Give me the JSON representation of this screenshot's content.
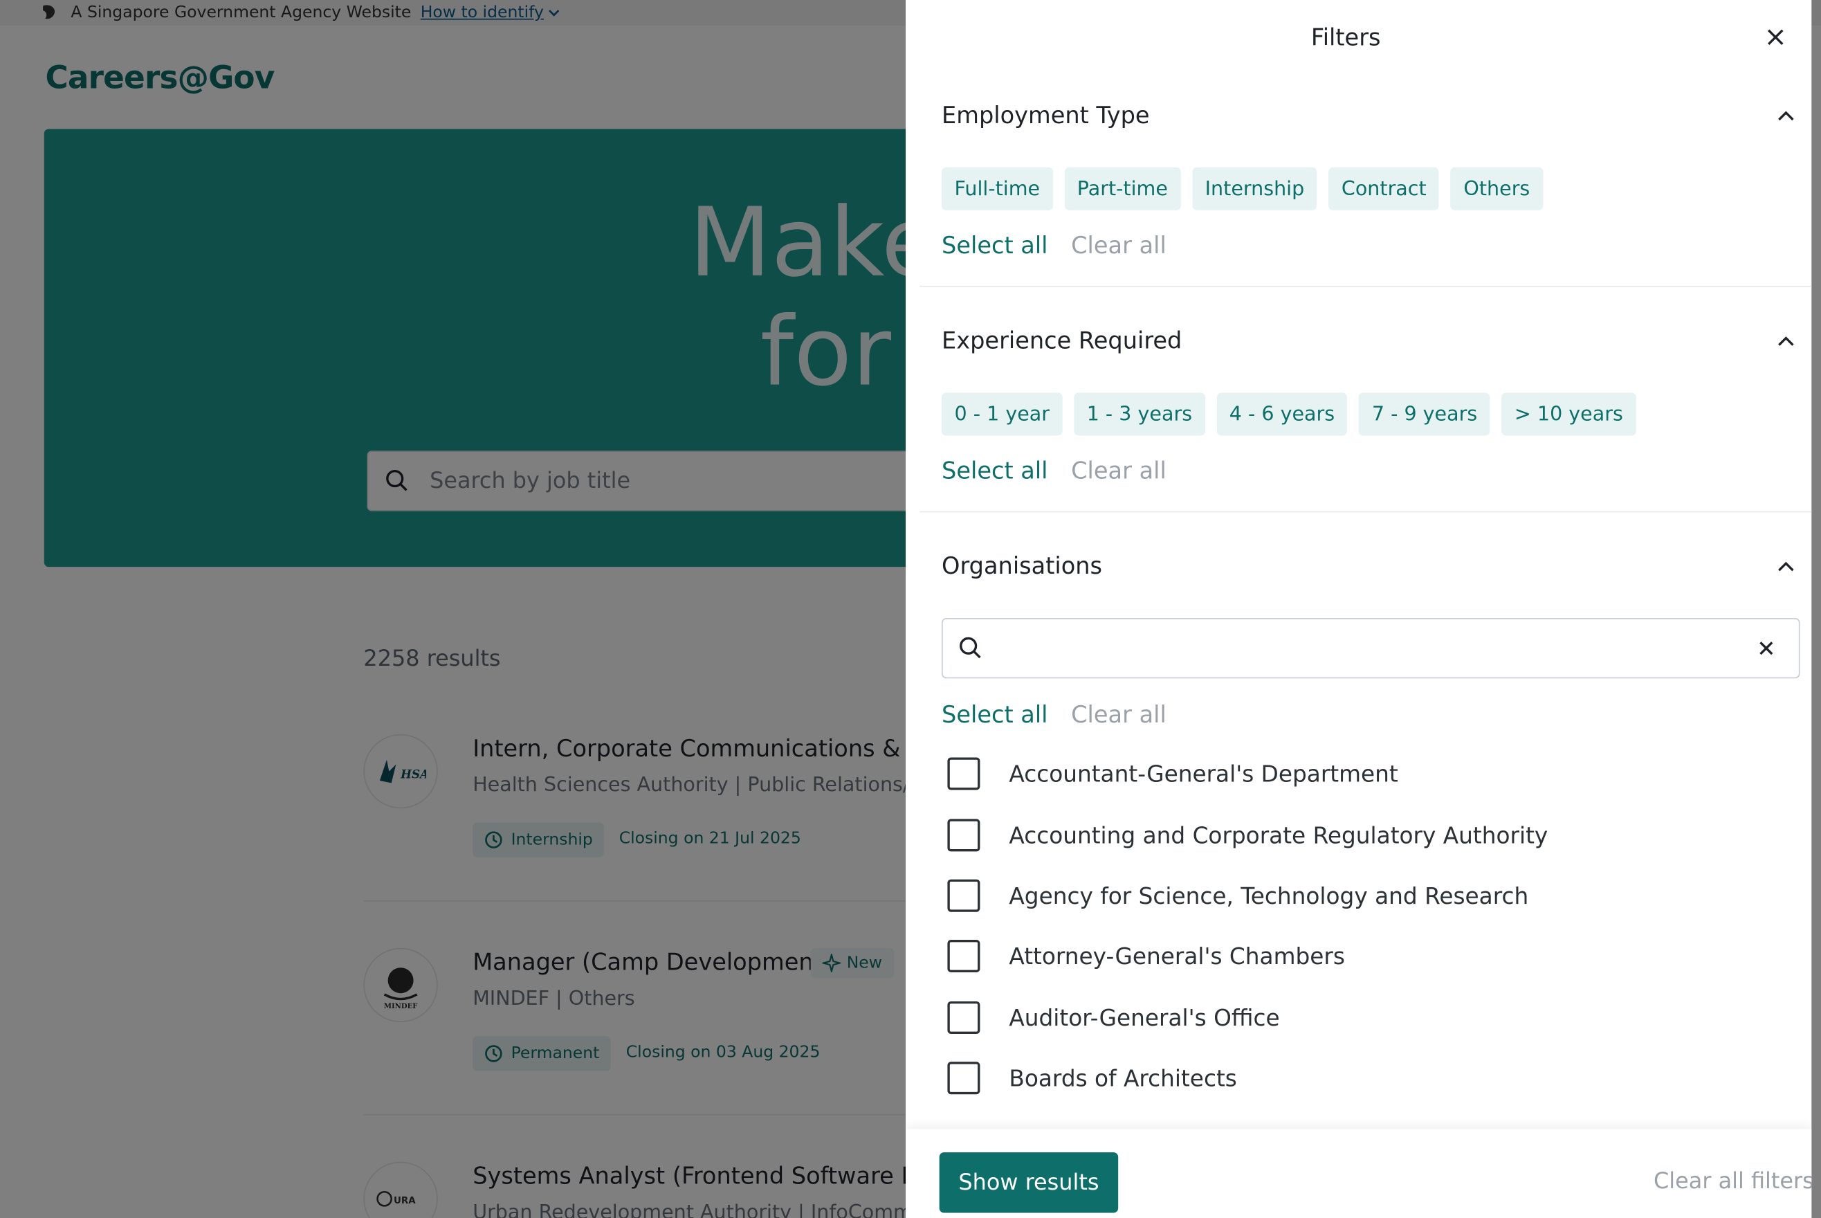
{
  "masthead": {
    "text": "A Singapore Government Agency Website",
    "link": "How to identify"
  },
  "brand": {
    "logo_text": "Careers@Gov"
  },
  "hero": {
    "headline_line1": "Make a D",
    "headline_line2": "for Tor",
    "search_placeholder": "Search by job title"
  },
  "results": {
    "count_text": "2258 results",
    "jobs": [
      {
        "title": "Intern, Corporate Communications & Serv",
        "subtitle": "Health Sciences Authority | Public Relations/Co",
        "type": "Internship",
        "closing": "Closing on 21 Jul 2025",
        "logo_text": "HSA",
        "is_new": false
      },
      {
        "title": "Manager (Camp Development)",
        "subtitle": "MINDEF | Others",
        "type": "Permanent",
        "closing": "Closing on 03 Aug 2025",
        "logo_text": "MINDEF",
        "is_new": true,
        "new_label": "New"
      },
      {
        "title": "Systems Analyst (Frontend Software Engi",
        "subtitle": "Urban Redevelopment Authority | InfoComm Te",
        "logo_text": "URA"
      }
    ]
  },
  "filters": {
    "title": "Filters",
    "employment": {
      "heading": "Employment Type",
      "chips": [
        "Full-time",
        "Part-time",
        "Internship",
        "Contract",
        "Others"
      ],
      "select_all": "Select all",
      "clear_all": "Clear all"
    },
    "experience": {
      "heading": "Experience Required",
      "chips": [
        "0 - 1 year",
        "1 - 3 years",
        "4 - 6 years",
        "7 - 9 years",
        "> 10 years"
      ],
      "select_all": "Select all",
      "clear_all": "Clear all"
    },
    "organisations": {
      "heading": "Organisations",
      "search_value": "",
      "select_all": "Select all",
      "clear_all": "Clear all",
      "items": [
        "Accountant-General's Department",
        "Accounting and Corporate Regulatory Authority",
        "Agency for Science, Technology and Research",
        "Attorney-General's Chambers",
        "Auditor-General's Office",
        "Boards of Architects"
      ]
    },
    "footer": {
      "show_results": "Show results",
      "clear_all_filters": "Clear all filters"
    }
  },
  "colors": {
    "brand_teal": "#0e6e6a",
    "hero_teal": "#1e9a93",
    "chip_bg": "#e6f3f2",
    "muted": "#9aa1a8"
  }
}
